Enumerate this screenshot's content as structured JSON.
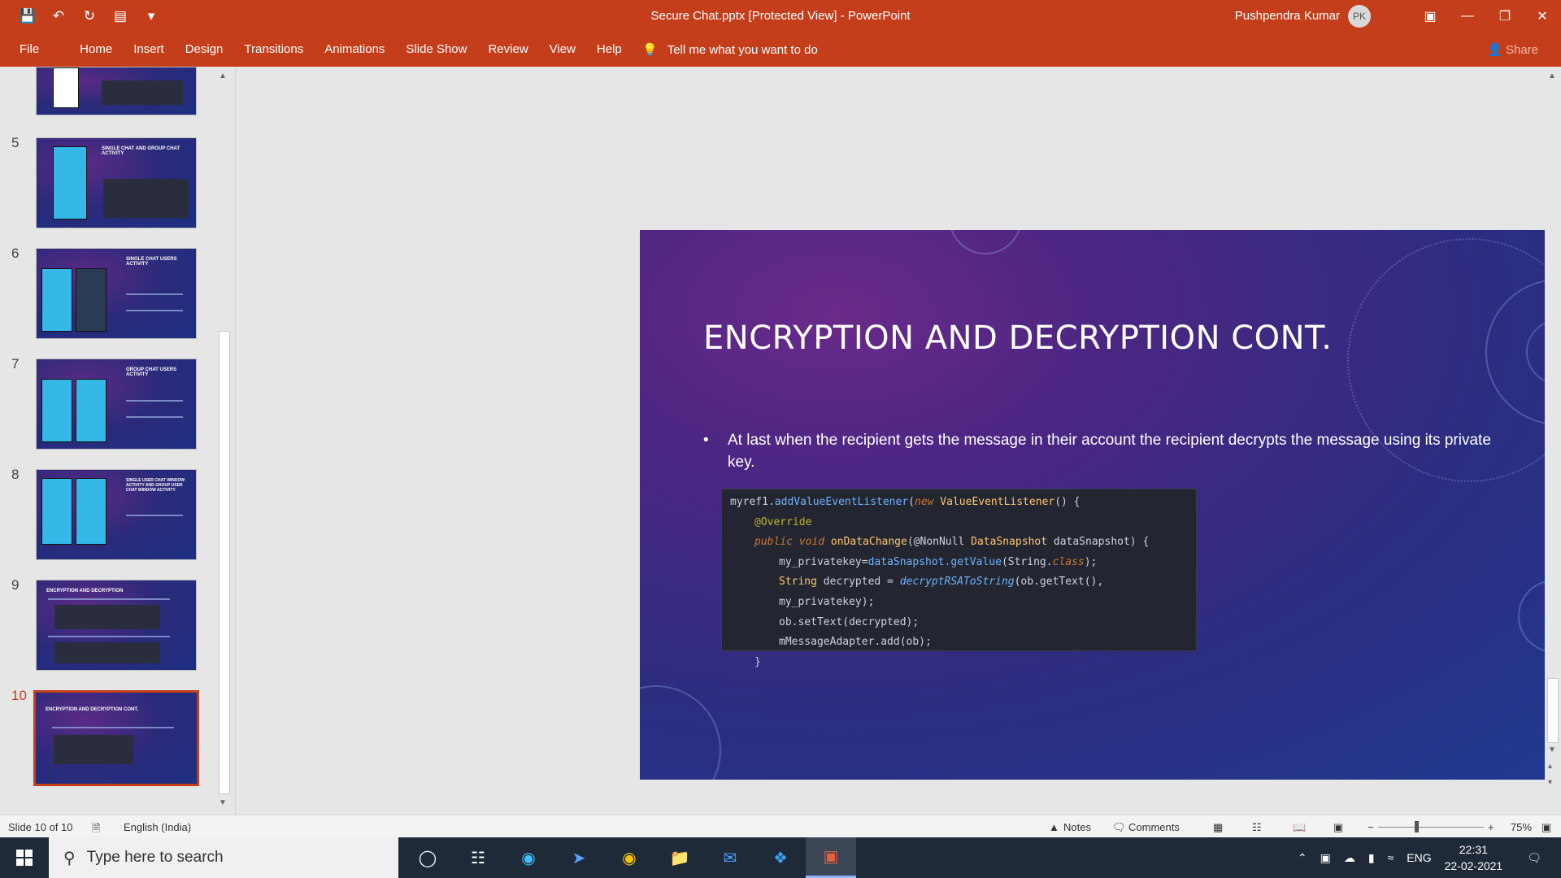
{
  "window": {
    "doc_title": "Secure Chat.pptx [Protected View]  -  PowerPoint",
    "user_name": "Pushpendra Kumar",
    "user_initials": "PK"
  },
  "ribbon": {
    "tabs": [
      "File",
      "Home",
      "Insert",
      "Design",
      "Transitions",
      "Animations",
      "Slide Show",
      "Review",
      "View",
      "Help"
    ],
    "tell_me": "Tell me what you want to do",
    "share": "Share"
  },
  "thumbnails": [
    {
      "num": "5",
      "title": "SINGLE CHAT AND GROUP CHAT ACTIVITY"
    },
    {
      "num": "6",
      "title": "SINGLE CHAT USERS ACTIVITY"
    },
    {
      "num": "7",
      "title": "GROUP CHAT USERS ACTIVITY"
    },
    {
      "num": "8",
      "title": "SINGLE USER CHAT WINDOW ACTIVITY AND GROUP USER CHAT WINDOW ACTIVITY"
    },
    {
      "num": "9",
      "title": "ENCRYPTION AND DECRYPTION"
    },
    {
      "num": "10",
      "title": "ENCRYPTION AND DECRYPTION CONT."
    }
  ],
  "slide": {
    "title": "ENCRYPTION AND DECRYPTION CONT.",
    "bullet": "At last when the recipient gets the message in their account the recipient decrypts the message using its private key.",
    "code": {
      "l1a": "myref1.",
      "l1b": "addValueEventListener",
      "l1c": "(",
      "l1d": "new",
      "l1e": " ValueEventListener",
      "l1f": "() {",
      "l2": "@Override",
      "l3a": "public void",
      "l3b": " onDataChange",
      "l3c": "(@NonNull ",
      "l3d": "DataSnapshot",
      "l3e": " dataSnapshot) {",
      "l4a": "my_privatekey=",
      "l4b": "dataSnapshot.getValue",
      "l4c": "(String.",
      "l4d": "class",
      "l4e": ");",
      "l5a": "String",
      "l5b": " decrypted = ",
      "l5c": "decryptRSAToString",
      "l5d": "(ob.getText(), my_privatekey);",
      "l6": "ob.setText(decrypted);",
      "l7": "mMessageAdapter.add(ob);",
      "l8": "}"
    }
  },
  "status": {
    "slide_count": "Slide 10 of 10",
    "language": "English (India)",
    "notes": "Notes",
    "comments": "Comments",
    "zoom": "75%"
  },
  "taskbar": {
    "search_placeholder": "Type here to search",
    "lang": "ENG",
    "time": "22:31",
    "date": "22-02-2021"
  }
}
